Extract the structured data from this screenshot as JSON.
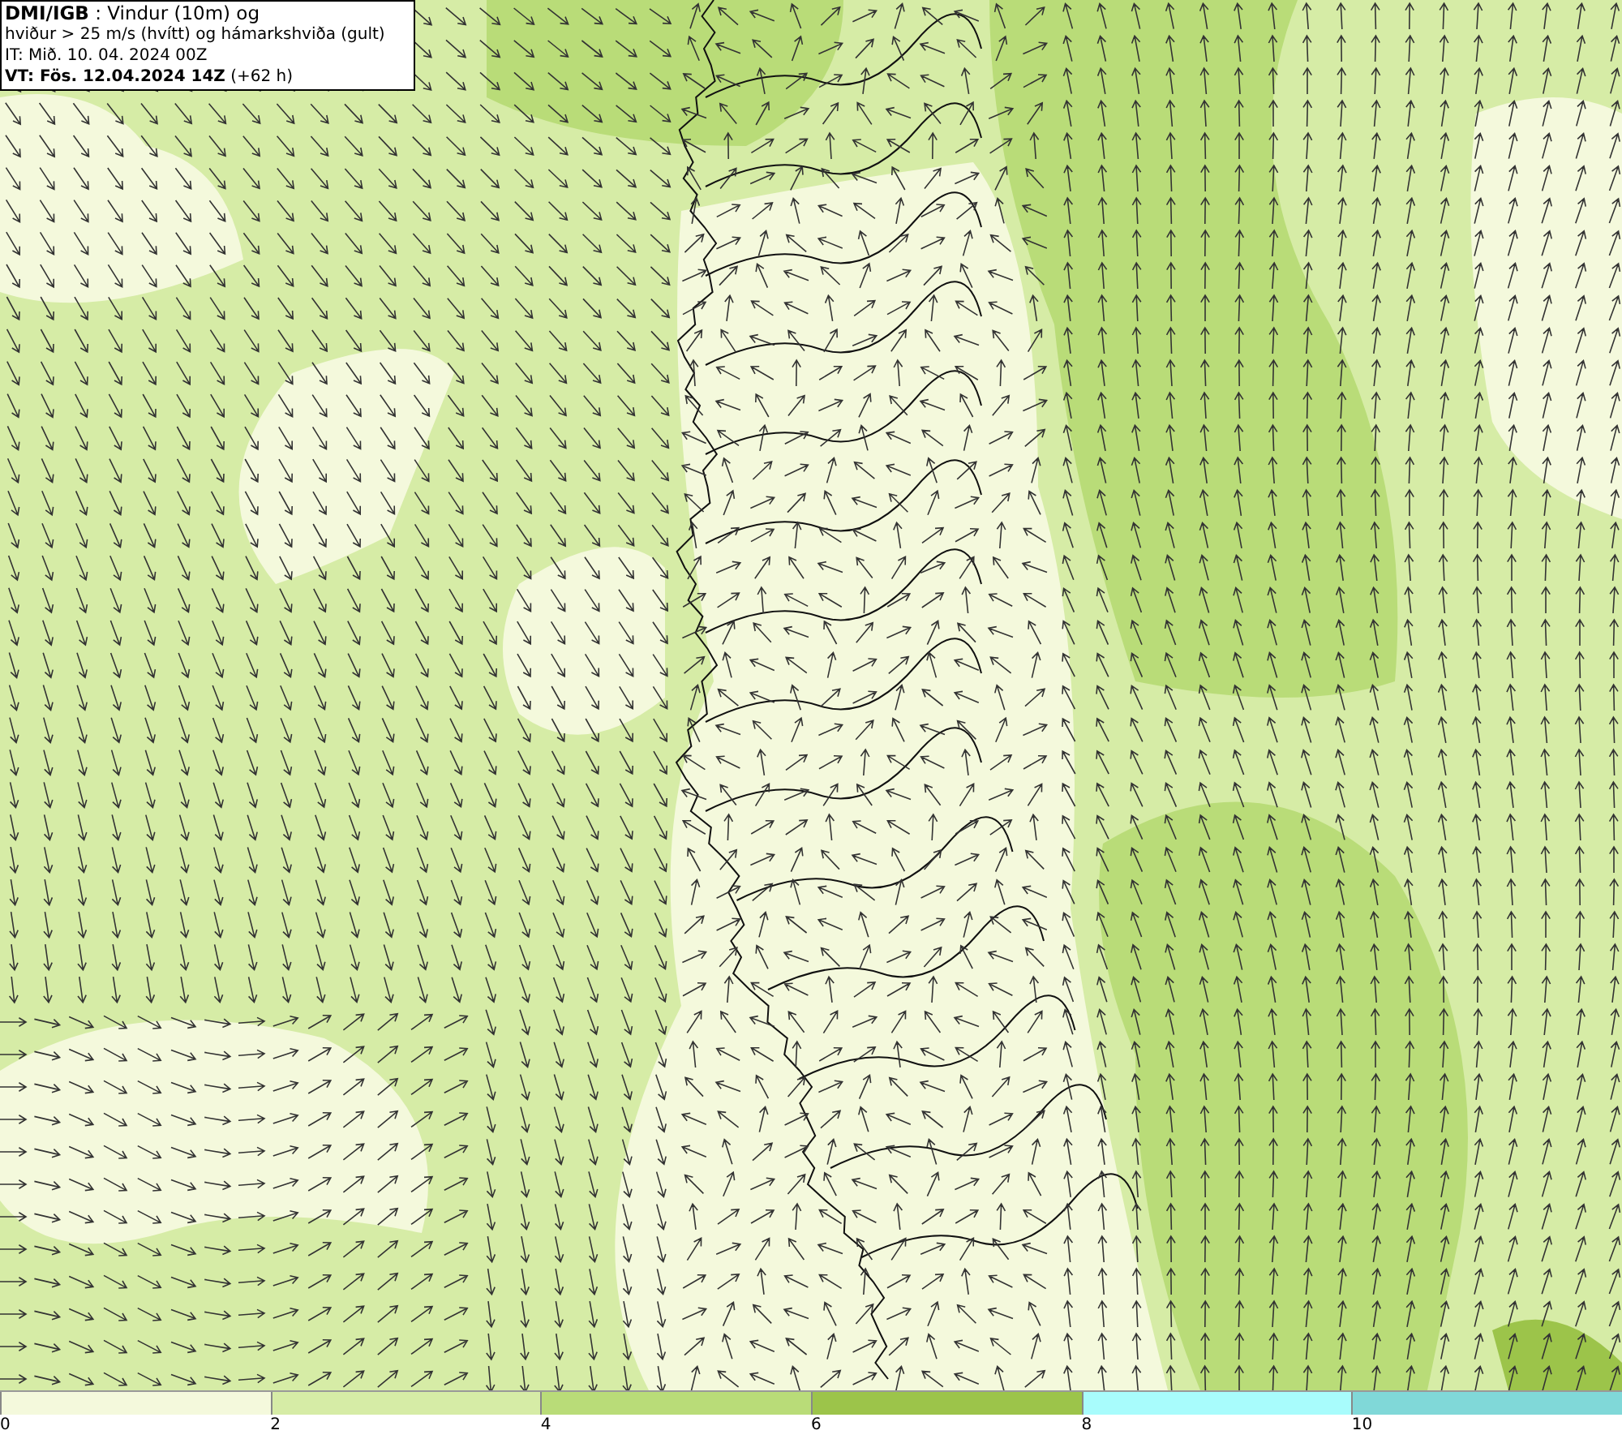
{
  "header": {
    "lines": [
      "**DMI/IGB** : Vindur (10m) og",
      "hviður > 25 m/s (hvítt) og hámarkshviða (gult)",
      "IT: Mið. 10. 04. 2024 00Z",
      "**VT: Fös. 12.04.2024 14Z** (+62 h)"
    ]
  },
  "legend": {
    "bins": [
      {
        "color": "#f4f9dc",
        "label": "0"
      },
      {
        "color": "#d6eca6",
        "label": "2"
      },
      {
        "color": "#b9dc78",
        "label": "4"
      },
      {
        "color": "#9cc44a",
        "label": "6"
      },
      {
        "color": "#a8fcfc",
        "label": "8"
      },
      {
        "color": "#80d8d8",
        "label": "10"
      }
    ]
  }
}
